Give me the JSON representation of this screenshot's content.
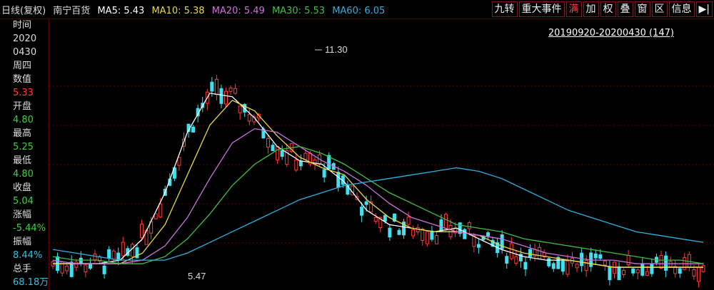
{
  "legend": {
    "period": "日线(复权)",
    "stock": "南宁百货",
    "ma5": "MA5: 5.43",
    "ma10": "MA10: 5.38",
    "ma20": "MA20: 5.49",
    "ma30": "MA30: 5.53",
    "ma60": "MA60: 6.05",
    "colors": {
      "period": "#dddddd",
      "stock": "#dddddd",
      "ma5": "#ffffff",
      "ma10": "#e6d84a",
      "ma20": "#d070e0",
      "ma30": "#40c040",
      "ma60": "#30b0e0"
    }
  },
  "toolbar": [
    "九转",
    "重大事件",
    "满",
    "加",
    "权",
    "叠",
    "窗",
    "区",
    "信息",
    "▶|"
  ],
  "range_label": "20190920-20200430 (147)",
  "sidebar": [
    {
      "label": "时间",
      "value": "2020",
      "value2": "0430",
      "color": "#dddddd"
    },
    {
      "label": "周四",
      "value": "",
      "color": "#dddddd"
    },
    {
      "label": "数值",
      "value": "5.33",
      "color": "#ff4040"
    },
    {
      "label": "开盘",
      "value": "4.80",
      "color": "#40d040"
    },
    {
      "label": "最高",
      "value": "5.25",
      "color": "#40d040"
    },
    {
      "label": "最低",
      "value": "4.80",
      "color": "#40d040"
    },
    {
      "label": "收盘",
      "value": "5.04",
      "color": "#40d040"
    },
    {
      "label": "涨幅",
      "value": "-5.44%",
      "color": "#40d040"
    },
    {
      "label": "振幅",
      "value": "8.44%",
      "color": "#30c0e0"
    },
    {
      "label": "总手",
      "value": "68.18万",
      "color": "#30c0e0"
    }
  ],
  "annotations": {
    "high": "11.30",
    "low": "5.47"
  },
  "chart_data": {
    "type": "line",
    "title": "",
    "series": [
      {
        "name": "MA5",
        "color": "#ffffff",
        "values": [
          5.5,
          5.5,
          5.5,
          5.6,
          6.2,
          7.5,
          9.2,
          10.3,
          10.2,
          9.6,
          8.8,
          8.4,
          8.3,
          7.8,
          7.0,
          6.6,
          6.5,
          6.4,
          6.5,
          6.2,
          5.9,
          5.7,
          5.6,
          5.6,
          5.5,
          5.4,
          5.4,
          5.4,
          5.4,
          5.4
        ]
      },
      {
        "name": "MA10",
        "color": "#e6d84a",
        "values": [
          5.5,
          5.5,
          5.5,
          5.5,
          5.8,
          6.6,
          8.0,
          9.4,
          10.1,
          9.8,
          9.1,
          8.5,
          8.2,
          8.0,
          7.3,
          6.8,
          6.5,
          6.4,
          6.4,
          6.3,
          6.0,
          5.8,
          5.7,
          5.6,
          5.5,
          5.4,
          5.4,
          5.4,
          5.4,
          5.4
        ]
      },
      {
        "name": "MA20",
        "color": "#d070e0",
        "values": [
          5.6,
          5.5,
          5.5,
          5.5,
          5.6,
          6.0,
          6.8,
          7.9,
          8.9,
          9.3,
          9.2,
          8.8,
          8.4,
          8.1,
          7.7,
          7.2,
          6.8,
          6.6,
          6.4,
          6.3,
          6.2,
          6.0,
          5.8,
          5.7,
          5.6,
          5.6,
          5.5,
          5.5,
          5.5,
          5.5
        ]
      },
      {
        "name": "MA30",
        "color": "#40c040",
        "values": [
          5.7,
          5.6,
          5.6,
          5.5,
          5.5,
          5.7,
          6.2,
          6.9,
          7.7,
          8.3,
          8.7,
          8.8,
          8.6,
          8.3,
          7.9,
          7.5,
          7.2,
          6.9,
          6.6,
          6.5,
          6.4,
          6.2,
          6.1,
          6.0,
          5.9,
          5.8,
          5.7,
          5.6,
          5.6,
          5.5
        ]
      },
      {
        "name": "MA60",
        "color": "#30b0e0",
        "values": [
          5.9,
          5.8,
          5.7,
          5.6,
          5.6,
          5.6,
          5.8,
          6.1,
          6.4,
          6.7,
          7.0,
          7.3,
          7.5,
          7.7,
          7.8,
          7.9,
          8.0,
          8.1,
          8.2,
          8.1,
          7.9,
          7.6,
          7.3,
          7.0,
          6.8,
          6.6,
          6.4,
          6.3,
          6.2,
          6.1
        ]
      }
    ],
    "ylim": [
      5.0,
      11.8
    ]
  }
}
